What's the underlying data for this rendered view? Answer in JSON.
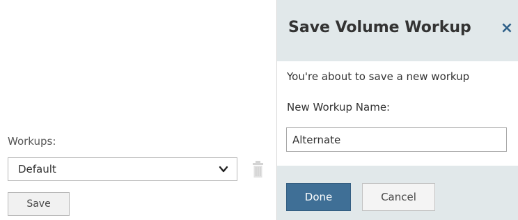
{
  "workups_panel": {
    "label": "Workups:",
    "select_value": "Default",
    "chevron_icon": "chevron-down-icon",
    "trash_icon": "trash-icon",
    "save_label": "Save"
  },
  "dialog": {
    "title": "Save Volume Workup",
    "close_icon": "close-icon",
    "close_glyph": "×",
    "message": "You're about to save a new workup",
    "name_label": "New Workup Name:",
    "name_value": "Alternate",
    "done_label": "Done",
    "cancel_label": "Cancel"
  },
  "colors": {
    "dialog_header_bg": "#e1e8ea",
    "primary_button": "#3f6f96",
    "close_icon": "#2d5f88"
  }
}
